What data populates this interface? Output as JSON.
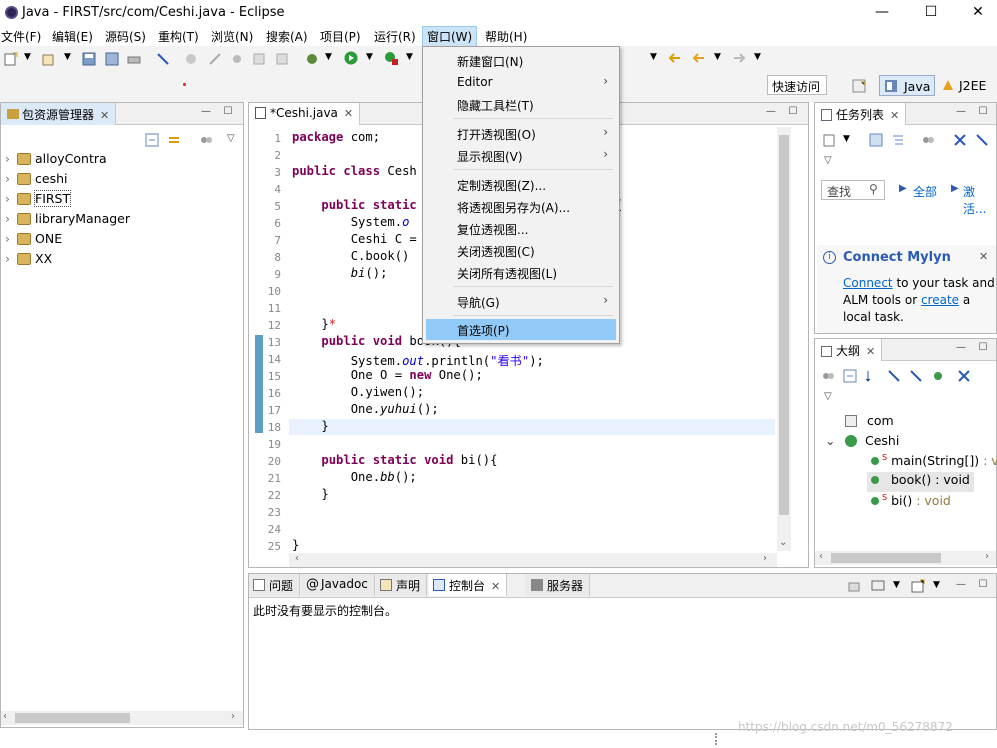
{
  "window": {
    "title": "Java - FIRST/src/com/Ceshi.java - Eclipse",
    "min": "—",
    "max": "☐",
    "close": "✕"
  },
  "menubar": {
    "items": [
      "文件(F)",
      "编辑(E)",
      "源码(S)",
      "重构(T)",
      "浏览(N)",
      "搜索(A)",
      "项目(P)",
      "运行(R)",
      "窗口(W)",
      "帮助(H)"
    ]
  },
  "toolbar": {
    "quick_access": "快速访问",
    "perspective_java": "Java",
    "perspective_j2ee": "J2EE"
  },
  "window_menu": {
    "items": [
      {
        "label": "新建窗口(N)",
        "arrow": ""
      },
      {
        "label": "Editor",
        "arrow": "›"
      },
      {
        "label": "隐藏工具栏(T)",
        "arrow": ""
      },
      {
        "label": "打开透视图(O)",
        "arrow": "›"
      },
      {
        "label": "显示视图(V)",
        "arrow": "›"
      },
      {
        "label": "定制透视图(Z)...",
        "arrow": ""
      },
      {
        "label": "将透视图另存为(A)...",
        "arrow": ""
      },
      {
        "label": "复位透视图...",
        "arrow": ""
      },
      {
        "label": "关闭透视图(C)",
        "arrow": ""
      },
      {
        "label": "关闭所有透视图(L)",
        "arrow": ""
      },
      {
        "label": "导航(G)",
        "arrow": "›"
      },
      {
        "label": "首选项(P)",
        "arrow": ""
      }
    ]
  },
  "package_explorer": {
    "tab": "包资源管理器",
    "projects": [
      "alloyContra",
      "ceshi",
      "FIRST",
      "libraryManager",
      "ONE",
      "XX"
    ]
  },
  "editor": {
    "tab": "*Ceshi.java",
    "line_numbers": [
      "1",
      "2",
      "3",
      "4",
      "5",
      "6",
      "7",
      "8",
      "9",
      "10",
      "11",
      "12",
      "13",
      "14",
      "15",
      "16",
      "17",
      "18",
      "19",
      "20",
      "21",
      "22",
      "23",
      "24",
      "25"
    ]
  },
  "task_list": {
    "tab": "任务列表",
    "find_placeholder": "查找",
    "all": "全部",
    "activate": "激活...",
    "mylyn_title": "Connect Mylyn",
    "mylyn_link1": "Connect",
    "mylyn_text1": " to your task and",
    "mylyn_text2": "ALM tools or ",
    "mylyn_link2": "create",
    "mylyn_text3": " a",
    "mylyn_text4": "local task."
  },
  "outline": {
    "tab": "大纲",
    "package": "com",
    "class": "Ceshi",
    "methods": [
      {
        "name": "main(String[])",
        "type": " : vo"
      },
      {
        "name": "book()",
        "type": " : void"
      },
      {
        "name": "bi()",
        "type": " : void"
      }
    ]
  },
  "bottom": {
    "tabs": [
      "问题",
      "Javadoc",
      "声明",
      "控制台",
      "服务器"
    ],
    "console_message": "此时没有要显示的控制台。",
    "watermark": "https://blog.csdn.net/m0_56278872"
  }
}
